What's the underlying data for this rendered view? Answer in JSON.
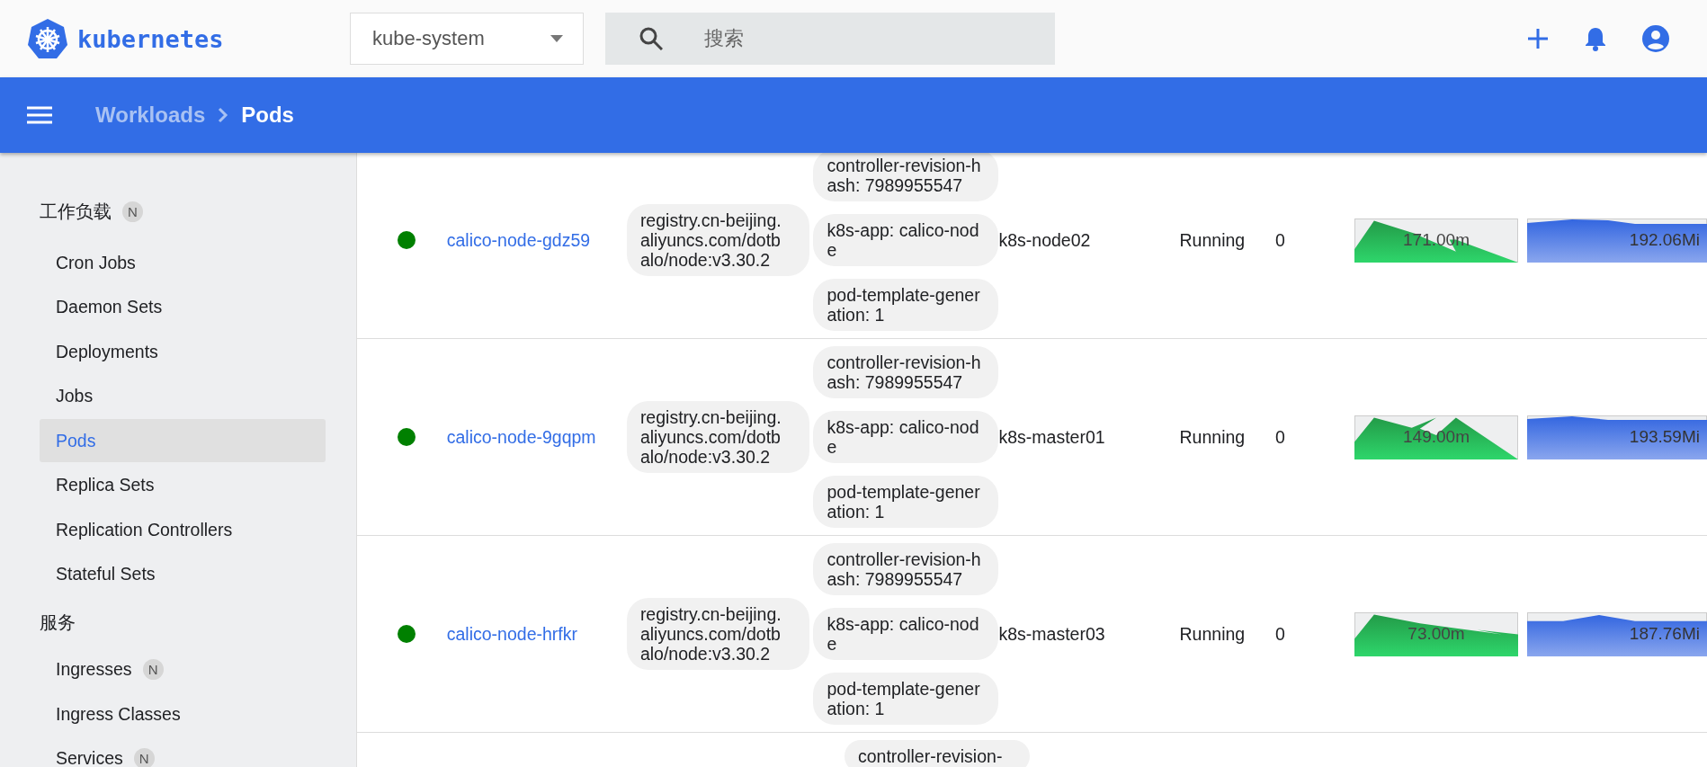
{
  "header": {
    "logo": "kubernetes",
    "namespace": "kube-system",
    "search": {
      "placeholder": "搜索"
    }
  },
  "breadcrumb": [
    "Workloads",
    "Pods"
  ],
  "sidebar": {
    "sections": [
      {
        "title": "工作负载",
        "badge": "N",
        "items": [
          {
            "label": "Cron Jobs",
            "selected": false
          },
          {
            "label": "Daemon Sets",
            "selected": false
          },
          {
            "label": "Deployments",
            "selected": false
          },
          {
            "label": "Jobs",
            "selected": false
          },
          {
            "label": "Pods",
            "selected": true
          },
          {
            "label": "Replica Sets",
            "selected": false
          },
          {
            "label": "Replication Controllers",
            "selected": false
          },
          {
            "label": "Stateful Sets",
            "selected": false
          }
        ]
      },
      {
        "title": "服务",
        "items": [
          {
            "label": "Ingresses",
            "badge": "N",
            "selected": false
          },
          {
            "label": "Ingress Classes",
            "selected": false
          },
          {
            "label": "Services",
            "badge": "N",
            "selected": false
          }
        ]
      }
    ]
  },
  "pods": [
    {
      "ready": true,
      "name": "calico-node-gdz59",
      "image": "registry.cn-beijing.aliyuncs.com/dotbalo/node:v3.30.2",
      "labels": [
        "controller-revision-hash: 7989955547",
        "k8s-app: calico-node",
        "pod-template-generation: 1"
      ],
      "node": "k8s-node02",
      "status": "Running",
      "restarts": "0",
      "cpu": "171.00m",
      "memory": "192.06Mi"
    },
    {
      "ready": true,
      "name": "calico-node-9gqpm",
      "image": "registry.cn-beijing.aliyuncs.com/dotbalo/node:v3.30.2",
      "labels": [
        "controller-revision-hash: 7989955547",
        "k8s-app: calico-node",
        "pod-template-generation: 1"
      ],
      "node": "k8s-master01",
      "status": "Running",
      "restarts": "0",
      "cpu": "149.00m",
      "memory": "193.59Mi"
    },
    {
      "ready": true,
      "name": "calico-node-hrfkr",
      "image": "registry.cn-beijing.aliyuncs.com/dotbalo/node:v3.30.2",
      "labels": [
        "controller-revision-hash: 7989955547",
        "k8s-app: calico-node",
        "pod-template-generation: 1"
      ],
      "node": "k8s-master03",
      "status": "Running",
      "restarts": "0",
      "cpu": "73.00m",
      "memory": "187.76Mi"
    },
    {
      "labels": [
        "controller-revision-"
      ]
    }
  ]
}
